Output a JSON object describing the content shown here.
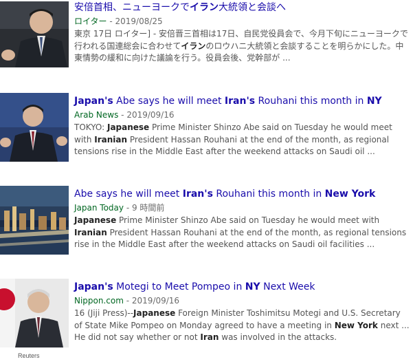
{
  "results": [
    {
      "title": [
        {
          "t": "安倍首相、ニューヨークで",
          "b": false
        },
        {
          "t": "イラン",
          "b": true
        },
        {
          "t": "大統領と会談へ",
          "b": false
        }
      ],
      "source": "ロイター",
      "date": "2019/08/25",
      "snippet": [
        {
          "t": "東京 17日 ロイター] - 安倍晋三首相は17日、自民党役員会で、今月下旬にニューヨークで行われる国連総会に合わせて",
          "b": false
        },
        {
          "t": "イラン",
          "b": true
        },
        {
          "t": "のロウハニ大統領と会談することを明らかにした。中東情勢の緩和に向けた議論を行う。役員会後、党幹部が ...",
          "b": false
        }
      ]
    },
    {
      "title": [
        {
          "t": "Japan's",
          "b": true
        },
        {
          "t": " Abe says he will meet ",
          "b": false
        },
        {
          "t": "Iran's",
          "b": true
        },
        {
          "t": " Rouhani this month in ",
          "b": false
        },
        {
          "t": "NY",
          "b": true
        }
      ],
      "source": "Arab News",
      "date": "2019/09/16",
      "snippet": [
        {
          "t": "TOKYO: ",
          "b": false
        },
        {
          "t": "Japanese",
          "b": true
        },
        {
          "t": " Prime Minister Shinzo Abe said on Tuesday he would meet with ",
          "b": false
        },
        {
          "t": "Iranian",
          "b": true
        },
        {
          "t": " President Hassan Rouhani at the end of the month, as regional tensions rise in the Middle East after the weekend attacks on Saudi oil ...",
          "b": false
        }
      ]
    },
    {
      "title": [
        {
          "t": "Abe says he will meet ",
          "b": false
        },
        {
          "t": "Iran's",
          "b": true
        },
        {
          "t": " Rouhani this month in ",
          "b": false
        },
        {
          "t": "New York",
          "b": true
        }
      ],
      "source": "Japan Today",
      "date": "9 時間前",
      "snippet": [
        {
          "t": "Japanese",
          "b": true
        },
        {
          "t": " Prime Minister Shinzo Abe said on Tuesday he would meet with ",
          "b": false
        },
        {
          "t": "Iranian",
          "b": true
        },
        {
          "t": " President Hassan Rouhani at the end of the month, as regional tensions rise in the Middle East after the weekend attacks on Saudi oil facilities ...",
          "b": false
        }
      ]
    },
    {
      "title": [
        {
          "t": "Japan's",
          "b": true
        },
        {
          "t": " Motegi to Meet Pompeo in ",
          "b": false
        },
        {
          "t": "NY",
          "b": true
        },
        {
          "t": " Next Week",
          "b": false
        }
      ],
      "source": "Nippon.com",
      "date": "2019/09/16",
      "snippet": [
        {
          "t": "16 (Jiji Press)--",
          "b": false
        },
        {
          "t": "Japanese",
          "b": true
        },
        {
          "t": " Foreign Minister Toshimitsu Motegi and U.S. Secretary of State Mike Pompeo on Monday agreed to have a meeting in ",
          "b": false
        },
        {
          "t": "New York",
          "b": true
        },
        {
          "t": " next ... He did not say whether or not ",
          "b": false
        },
        {
          "t": "Iran",
          "b": true
        },
        {
          "t": " was involved in the attacks.",
          "b": false
        }
      ]
    }
  ],
  "meta_separator": " - ",
  "thumb_caption": "Reuters",
  "colors": {
    "title": "#1a0dab",
    "source": "#006621",
    "date": "#6a6a6a",
    "snippet": "#545454"
  }
}
